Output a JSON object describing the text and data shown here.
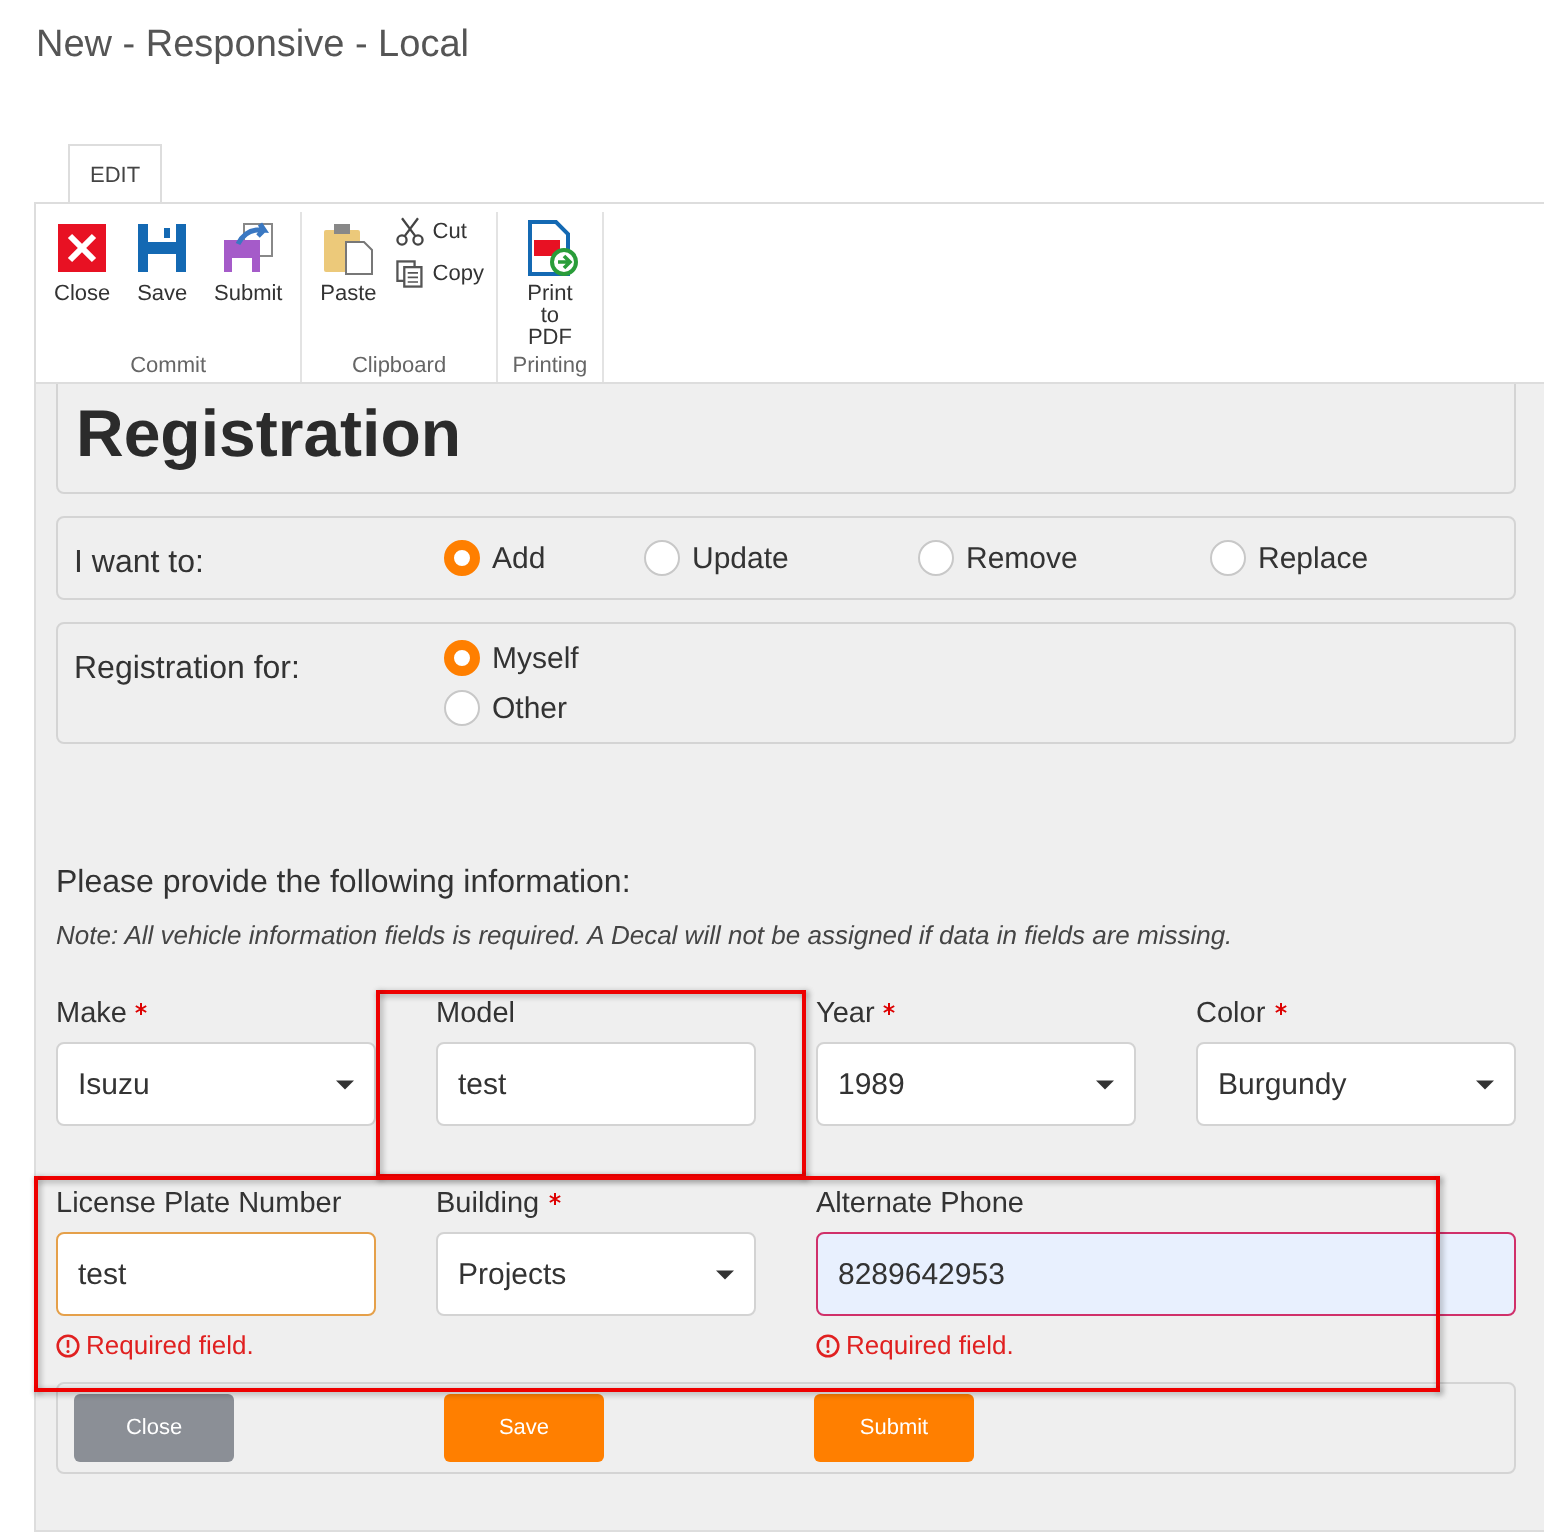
{
  "page_title": "New - Responsive - Local",
  "ribbon": {
    "tabs": [
      {
        "label": "EDIT",
        "selected": true
      }
    ],
    "groups": [
      {
        "name": "Commit",
        "buttons": [
          {
            "label": "Close",
            "kind": "large"
          },
          {
            "label": "Save",
            "kind": "large"
          },
          {
            "label": "Submit",
            "kind": "large"
          }
        ]
      },
      {
        "name": "Clipboard",
        "buttons": [
          {
            "label": "Paste",
            "kind": "large"
          },
          {
            "label": "Cut",
            "kind": "small"
          },
          {
            "label": "Copy",
            "kind": "small"
          }
        ]
      },
      {
        "name": "Printing",
        "buttons": [
          {
            "label": "Print to PDF",
            "kind": "large"
          }
        ]
      }
    ]
  },
  "form": {
    "header": {
      "title_lines": [
        "Registration"
      ]
    },
    "radio_groups": [
      {
        "label": "I want to:",
        "kind": "inline",
        "options": [
          {
            "label": "Add",
            "selected": true
          },
          {
            "label": "Update",
            "selected": false
          },
          {
            "label": "Remove",
            "selected": false
          },
          {
            "label": "Replace",
            "selected": false
          }
        ]
      },
      {
        "label": "Registration for:",
        "kind": "stacked",
        "options": [
          {
            "label": "Myself",
            "selected": true
          },
          {
            "label": "Other",
            "selected": false
          }
        ]
      }
    ],
    "intro": "Please provide the following information:",
    "note": "Note:  All vehicle information fields is required.  A Decal will not be assigned if data in fields are missing.",
    "field_rows": [
      [
        {
          "label": "Make",
          "required": true,
          "kind": "select",
          "value": "Isuzu"
        },
        {
          "label": "Model",
          "required": false,
          "kind": "text",
          "value": "test"
        },
        {
          "label": "Year",
          "required": true,
          "kind": "select",
          "value": "1989"
        },
        {
          "label": "Color",
          "required": true,
          "kind": "select",
          "value": "Burgundy"
        }
      ],
      [
        {
          "label": "License Plate Number",
          "required": false,
          "kind": "text",
          "value": "test",
          "focused": true,
          "error": "Required field."
        },
        {
          "label": "Building",
          "required": true,
          "kind": "select",
          "value": "Projects"
        },
        {
          "label": "Alternate Phone",
          "required": false,
          "kind": "text",
          "value": "8289642953",
          "invalid": true,
          "autofilled": true,
          "error": "Required field."
        }
      ]
    ],
    "actions": [
      {
        "label": "Close",
        "kind": "secondary"
      },
      {
        "label": "Save",
        "kind": "primary"
      },
      {
        "label": "Submit",
        "kind": "primary"
      }
    ]
  }
}
